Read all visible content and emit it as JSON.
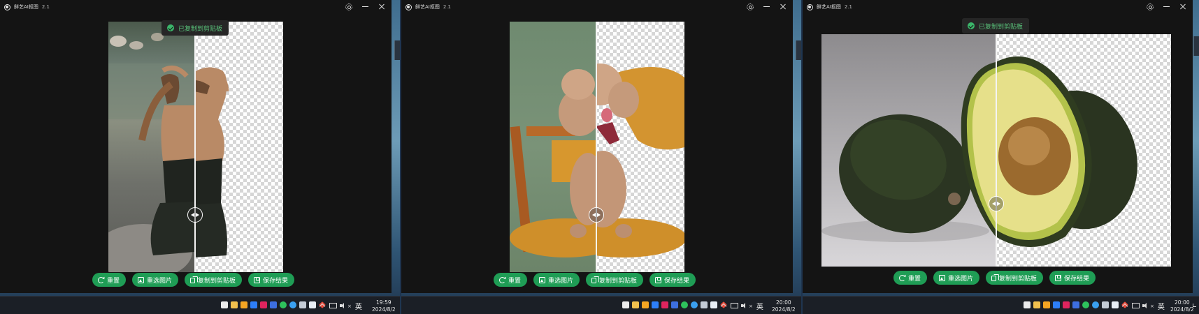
{
  "app": {
    "title": "鲜艺AI抠图",
    "version": "2.1"
  },
  "toast": {
    "message": "已复制到剪贴板"
  },
  "actions": {
    "reset": "重置",
    "reselect": "重选图片",
    "copy": "复制到剪贴板",
    "save": "保存结果"
  },
  "windows": [
    {
      "subject": "woman",
      "toast_visible": true,
      "divider_fraction": 0.49,
      "clock": {
        "time": "19:59",
        "date": "2024/8/2"
      }
    },
    {
      "subject": "poodle",
      "toast_visible": false,
      "divider_fraction": 0.49,
      "clock": {
        "time": "20:00",
        "date": "2024/8/2"
      }
    },
    {
      "subject": "avocado",
      "toast_visible": true,
      "divider_fraction": 0.5,
      "clock": {
        "time": "20:00",
        "date": "2024/8/2"
      }
    }
  ],
  "taskbar": {
    "ime": "英"
  },
  "colors": {
    "accent": "#1f9d55",
    "toast_text": "#59c27a",
    "window_bg": "#141414"
  },
  "icons": [
    "app-logo-icon",
    "gear-icon",
    "minimize-icon",
    "close-icon",
    "check-circle-icon",
    "refresh-icon",
    "image-icon",
    "copy-icon",
    "save-icon",
    "slider-handle-icon"
  ]
}
